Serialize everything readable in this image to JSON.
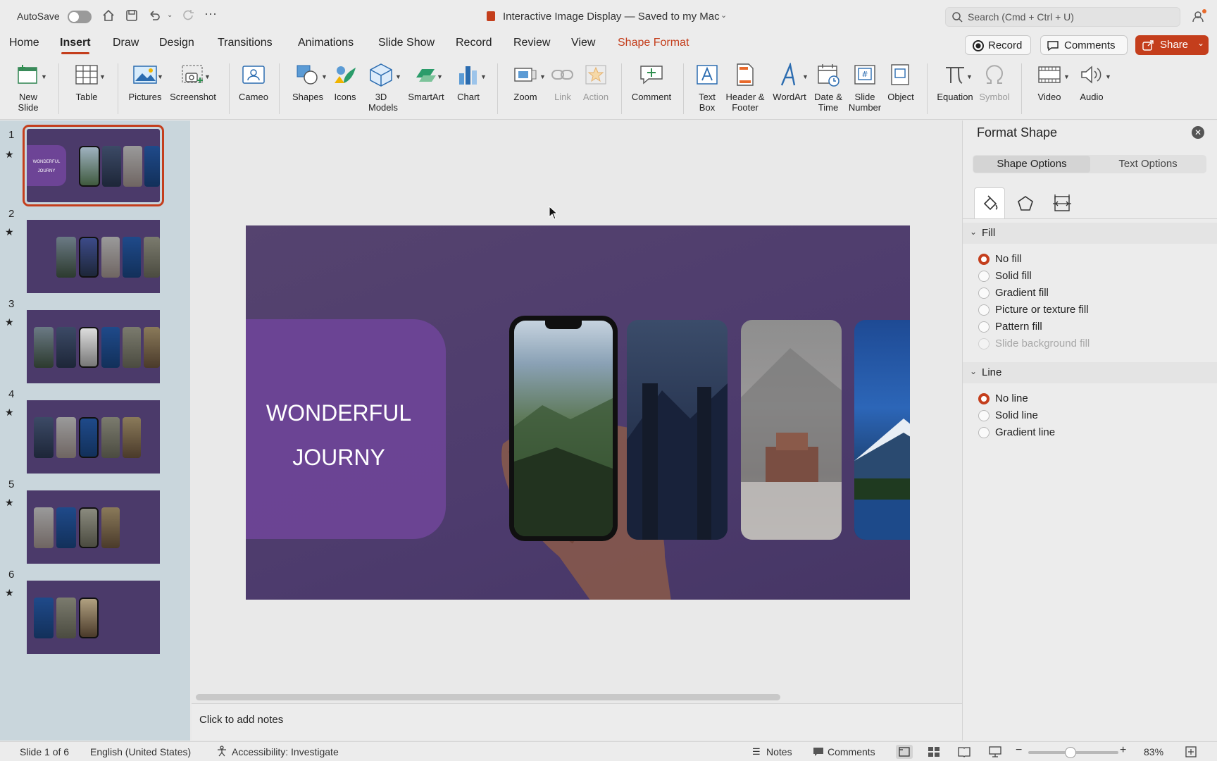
{
  "titlebar": {
    "autosave_label": "AutoSave",
    "doc_title": "Interactive Image Display — Saved to my Mac",
    "search_placeholder": "Search (Cmd + Ctrl + U)"
  },
  "tabs": [
    "Home",
    "Insert",
    "Draw",
    "Design",
    "Transitions",
    "Animations",
    "Slide Show",
    "Record",
    "Review",
    "View",
    "Shape Format"
  ],
  "active_tab": "Insert",
  "ribbon_actions": {
    "record": "Record",
    "comments": "Comments",
    "share": "Share"
  },
  "ribbon": {
    "new_slide": "New Slide",
    "table": "Table",
    "pictures": "Pictures",
    "screenshot": "Screenshot",
    "cameo": "Cameo",
    "shapes": "Shapes",
    "icons": "Icons",
    "models": "3D Models",
    "smartart": "SmartArt",
    "chart": "Chart",
    "zoom": "Zoom",
    "link": "Link",
    "action": "Action",
    "comment": "Comment",
    "textbox": "Text Box",
    "header_footer": "Header & Footer",
    "wordart": "WordArt",
    "datetime": "Date & Time",
    "slide_number": "Slide Number",
    "object": "Object",
    "equation": "Equation",
    "symbol": "Symbol",
    "video": "Video",
    "audio": "Audio"
  },
  "thumbnails": [
    {
      "num": "1",
      "title_line1": "WONDERFUL",
      "title_line2": "JOURNY"
    },
    {
      "num": "2"
    },
    {
      "num": "3"
    },
    {
      "num": "4"
    },
    {
      "num": "5"
    },
    {
      "num": "6"
    }
  ],
  "slide": {
    "title_line1": "WONDERFUL",
    "title_line2": "JOURNY"
  },
  "notes_placeholder": "Click to add notes",
  "panel": {
    "title": "Format Shape",
    "tab_shape": "Shape Options",
    "tab_text": "Text Options",
    "fill_header": "Fill",
    "fill_options": [
      "No fill",
      "Solid fill",
      "Gradient fill",
      "Picture or texture fill",
      "Pattern fill",
      "Slide background fill"
    ],
    "line_header": "Line",
    "line_options": [
      "No line",
      "Solid line",
      "Gradient line"
    ]
  },
  "status": {
    "slide_info": "Slide 1 of 6",
    "language": "English (United States)",
    "accessibility": "Accessibility: Investigate",
    "notes": "Notes",
    "comments": "Comments",
    "zoom": "83%"
  },
  "colors": {
    "accent": "#c43e1c",
    "slide_bg": "#4d3b6d",
    "title_box": "#6d4496"
  }
}
